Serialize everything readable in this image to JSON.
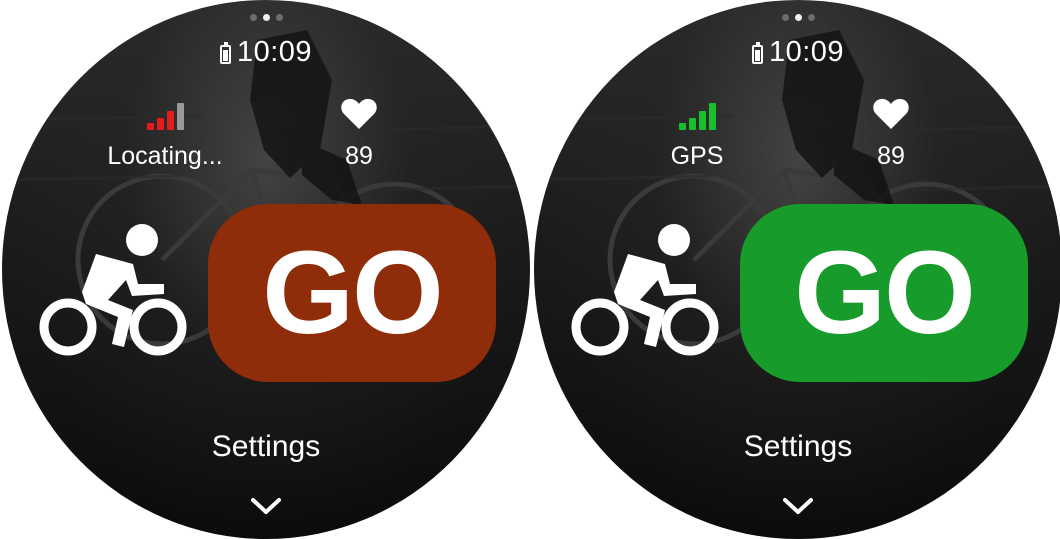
{
  "screens": [
    {
      "id": "left",
      "time": "10:09",
      "gps_label": "Locating...",
      "signal_color": "#e41c1c",
      "signal_level": 3,
      "heart_rate": "89",
      "go_label": "GO",
      "go_color": "#8f2c0a",
      "settings_label": "Settings",
      "active_dot": 1,
      "icons": [
        "battery-icon",
        "signal-bars-icon",
        "heart-icon",
        "cycling-icon",
        "chevron-down-icon"
      ]
    },
    {
      "id": "right",
      "time": "10:09",
      "gps_label": "GPS",
      "signal_color": "#19c02e",
      "signal_level": 4,
      "heart_rate": "89",
      "go_label": "GO",
      "go_color": "#179b2a",
      "settings_label": "Settings",
      "active_dot": 1,
      "icons": [
        "battery-icon",
        "signal-bars-icon",
        "heart-icon",
        "cycling-icon",
        "chevron-down-icon"
      ]
    }
  ]
}
